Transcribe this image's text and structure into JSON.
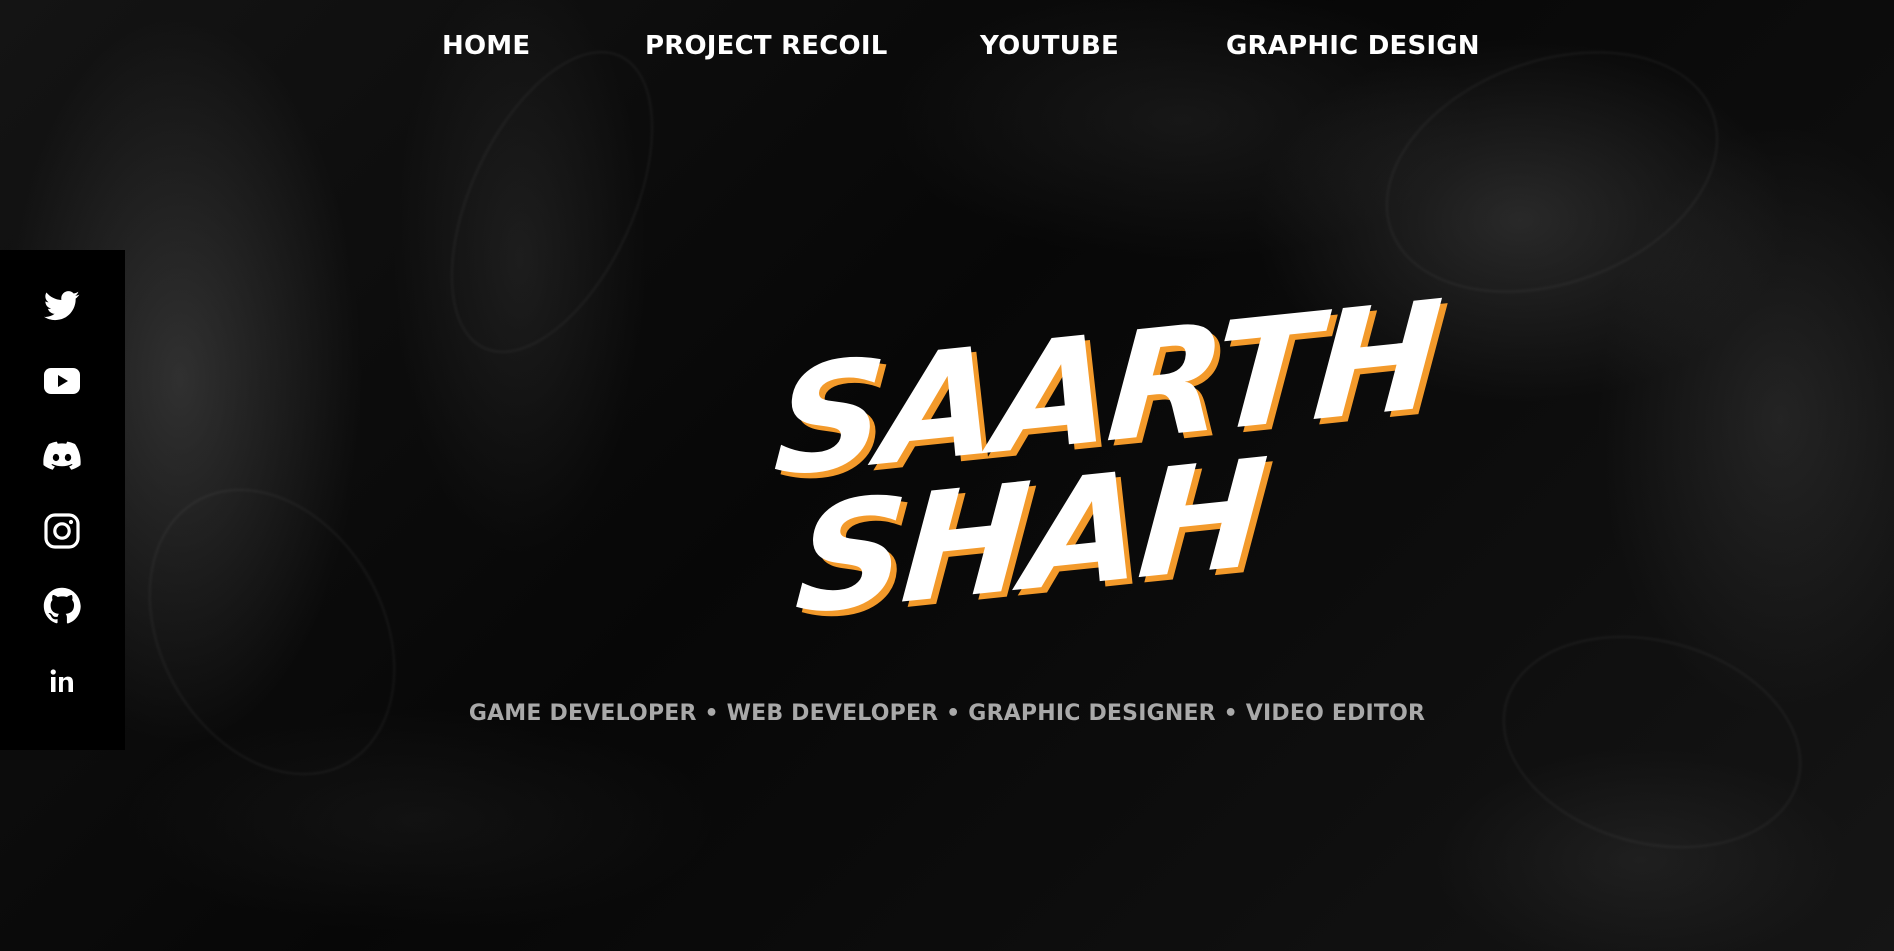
{
  "nav": {
    "items": [
      {
        "label": "HOME"
      },
      {
        "label": "PROJECT RECOIL"
      },
      {
        "label": "YOUTUBE"
      },
      {
        "label": "GRAPHIC DESIGN"
      }
    ]
  },
  "social": {
    "icons": [
      "twitter-icon",
      "youtube-icon",
      "discord-icon",
      "instagram-icon",
      "github-icon",
      "linkedin-icon"
    ]
  },
  "hero": {
    "logo_line1": "SAARTH",
    "logo_line2": "SHAH",
    "tagline": "GAME DEVELOPER • WEB DEVELOPER • GRAPHIC DESIGNER • VIDEO EDITOR"
  },
  "colors": {
    "background": "#050505",
    "nav_text": "#ffffff",
    "logo_fill": "#ffffff",
    "logo_accent": "#f39a2b",
    "tagline": "#a9a9a9",
    "social_bar": "#000000"
  }
}
